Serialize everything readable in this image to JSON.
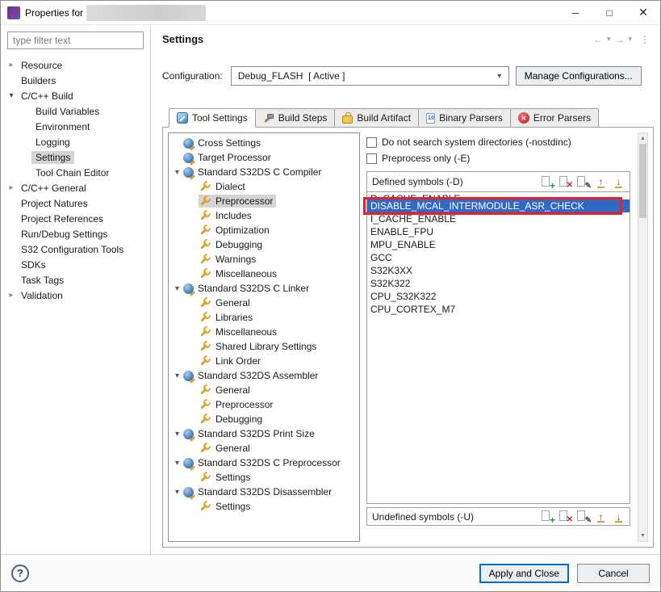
{
  "window": {
    "title": "Properties for",
    "minimize_glyph": "─",
    "maximize_glyph": "□",
    "close_glyph": "✕"
  },
  "sidebar": {
    "filter_placeholder": "type filter text",
    "items": [
      {
        "label": "Resource",
        "depth": 0,
        "arrow": "collapsed"
      },
      {
        "label": "Builders",
        "depth": 0,
        "arrow": "none"
      },
      {
        "label": "C/C++ Build",
        "depth": 0,
        "arrow": "expanded"
      },
      {
        "label": "Build Variables",
        "depth": 1,
        "arrow": "none"
      },
      {
        "label": "Environment",
        "depth": 1,
        "arrow": "none"
      },
      {
        "label": "Logging",
        "depth": 1,
        "arrow": "none"
      },
      {
        "label": "Settings",
        "depth": 1,
        "arrow": "none",
        "selected": true
      },
      {
        "label": "Tool Chain Editor",
        "depth": 1,
        "arrow": "none"
      },
      {
        "label": "C/C++ General",
        "depth": 0,
        "arrow": "collapsed"
      },
      {
        "label": "Project Natures",
        "depth": 0,
        "arrow": "none"
      },
      {
        "label": "Project References",
        "depth": 0,
        "arrow": "none"
      },
      {
        "label": "Run/Debug Settings",
        "depth": 0,
        "arrow": "none"
      },
      {
        "label": "S32 Configuration Tools",
        "depth": 0,
        "arrow": "none"
      },
      {
        "label": "SDKs",
        "depth": 0,
        "arrow": "none"
      },
      {
        "label": "Task Tags",
        "depth": 0,
        "arrow": "none"
      },
      {
        "label": "Validation",
        "depth": 0,
        "arrow": "collapsed"
      }
    ]
  },
  "header": {
    "title": "Settings",
    "back_glyph": "←",
    "forward_glyph": "→",
    "dropdown_glyph": "▾",
    "menu_glyph": "⋮"
  },
  "config": {
    "label": "Configuration:",
    "value": "Debug_FLASH  [ Active ]",
    "dropdown_glyph": "▾",
    "manage_button": "Manage Configurations..."
  },
  "tabs": [
    {
      "label": "Tool Settings",
      "active": true
    },
    {
      "label": "Build Steps",
      "active": false
    },
    {
      "label": "Build Artifact",
      "active": false
    },
    {
      "label": "Binary Parsers",
      "active": false
    },
    {
      "label": "Error Parsers",
      "active": false
    }
  ],
  "tool_tree": {
    "items": [
      {
        "label": "Cross Settings",
        "type": "cat",
        "depth": 0,
        "arrow": "none"
      },
      {
        "label": "Target Processor",
        "type": "cat",
        "depth": 0,
        "arrow": "none"
      },
      {
        "label": "Standard S32DS C Compiler",
        "type": "cat",
        "depth": 0,
        "arrow": "expanded"
      },
      {
        "label": "Dialect",
        "type": "item",
        "depth": 1,
        "arrow": "none"
      },
      {
        "label": "Preprocessor",
        "type": "item",
        "depth": 1,
        "arrow": "none",
        "selected": true
      },
      {
        "label": "Includes",
        "type": "item",
        "depth": 1,
        "arrow": "none"
      },
      {
        "label": "Optimization",
        "type": "item",
        "depth": 1,
        "arrow": "none"
      },
      {
        "label": "Debugging",
        "type": "item",
        "depth": 1,
        "arrow": "none"
      },
      {
        "label": "Warnings",
        "type": "item",
        "depth": 1,
        "arrow": "none"
      },
      {
        "label": "Miscellaneous",
        "type": "item",
        "depth": 1,
        "arrow": "none"
      },
      {
        "label": "Standard S32DS C Linker",
        "type": "cat",
        "depth": 0,
        "arrow": "expanded"
      },
      {
        "label": "General",
        "type": "item",
        "depth": 1,
        "arrow": "none"
      },
      {
        "label": "Libraries",
        "type": "item",
        "depth": 1,
        "arrow": "none"
      },
      {
        "label": "Miscellaneous",
        "type": "item",
        "depth": 1,
        "arrow": "none"
      },
      {
        "label": "Shared Library Settings",
        "type": "item",
        "depth": 1,
        "arrow": "none"
      },
      {
        "label": "Link Order",
        "type": "item",
        "depth": 1,
        "arrow": "none"
      },
      {
        "label": "Standard S32DS Assembler",
        "type": "cat",
        "depth": 0,
        "arrow": "expanded"
      },
      {
        "label": "General",
        "type": "item",
        "depth": 1,
        "arrow": "none"
      },
      {
        "label": "Preprocessor",
        "type": "item",
        "depth": 1,
        "arrow": "none"
      },
      {
        "label": "Debugging",
        "type": "item",
        "depth": 1,
        "arrow": "none"
      },
      {
        "label": "Standard S32DS Print Size",
        "type": "cat",
        "depth": 0,
        "arrow": "expanded"
      },
      {
        "label": "General",
        "type": "item",
        "depth": 1,
        "arrow": "none"
      },
      {
        "label": "Standard S32DS C Preprocessor",
        "type": "cat",
        "depth": 0,
        "arrow": "expanded"
      },
      {
        "label": "Settings",
        "type": "item",
        "depth": 1,
        "arrow": "none"
      },
      {
        "label": "Standard S32DS Disassembler",
        "type": "cat",
        "depth": 0,
        "arrow": "expanded"
      },
      {
        "label": "Settings",
        "type": "item",
        "depth": 1,
        "arrow": "none"
      }
    ]
  },
  "options": {
    "nostdinc": {
      "label": "Do not search system directories (-nostdinc)",
      "checked": false
    },
    "preprocess": {
      "label": "Preprocess only (-E)",
      "checked": false
    },
    "defined": {
      "label": "Defined symbols (-D)",
      "items": [
        {
          "text": "D_CACHE_ENABLE",
          "clipped": true
        },
        {
          "text": "DISABLE_MCAL_INTERMODULE_ASR_CHECK",
          "selected": true,
          "annotated": true
        },
        {
          "text": "I_CACHE_ENABLE"
        },
        {
          "text": "ENABLE_FPU"
        },
        {
          "text": "MPU_ENABLE"
        },
        {
          "text": "GCC"
        },
        {
          "text": "S32K3XX"
        },
        {
          "text": "S32K322"
        },
        {
          "text": "CPU_S32K322"
        },
        {
          "text": "CPU_CORTEX_M7"
        }
      ]
    },
    "undefined": {
      "label": "Undefined symbols (-U)"
    }
  },
  "icons": {
    "add": "+",
    "remove": "✕",
    "edit": "✎",
    "move_up": "↑",
    "move_down": "↓",
    "help": "?",
    "scroll_up": "▲",
    "scroll_down": "▼"
  },
  "footer": {
    "apply_label": "Apply and Close",
    "cancel_label": "Cancel"
  },
  "colors": {
    "selection_blue": "#316ac5",
    "annotation_red": "#ee1c25",
    "accent": "#0b6bbd"
  }
}
